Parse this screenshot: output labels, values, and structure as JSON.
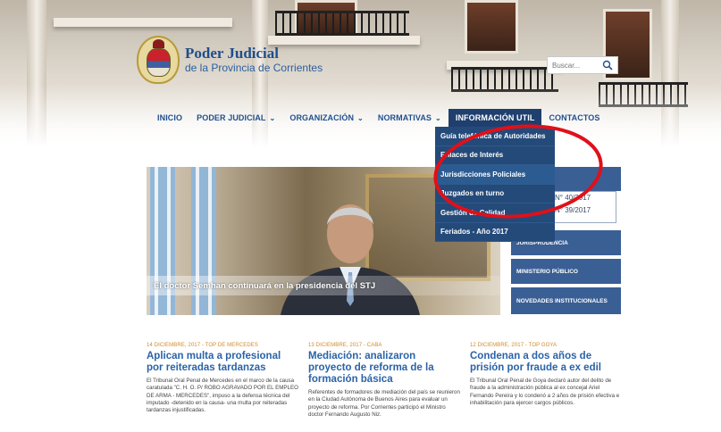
{
  "header": {
    "logo_title": "Poder Judicial",
    "logo_subtitle": "de la Provincia de Corrientes",
    "search_placeholder": "Buscar..."
  },
  "nav": {
    "items": [
      {
        "label": "INICIO"
      },
      {
        "label": "PODER JUDICIAL"
      },
      {
        "label": "ORGANIZACIÓN"
      },
      {
        "label": "NORMATIVAS"
      },
      {
        "label": "INFORMACIÓN UTIL"
      },
      {
        "label": "CONTACTOS"
      }
    ]
  },
  "dropdown": {
    "items": [
      {
        "label": "Guía telefónica de Autoridades"
      },
      {
        "label": "Enlaces de Interés"
      },
      {
        "label": "Jurisdicciones Policiales"
      },
      {
        "label": "Juzgados en turno"
      },
      {
        "label": "Gestión de Calidad"
      },
      {
        "label": "Feriados - Año 2017"
      }
    ],
    "highlighted_index": 2
  },
  "slider": {
    "caption": "El doctor Semhan continuará en la presidencia del STJ"
  },
  "sidebar": {
    "acordadas": [
      "N° 40/2017",
      "N° 39/2017"
    ],
    "items": [
      {
        "label": "JURISPRUDENCIA"
      },
      {
        "label": "MINISTERIO PÚBLICO"
      },
      {
        "label": "NOVEDADES INSTITUCIONALES"
      }
    ]
  },
  "news": [
    {
      "meta": "14 DICIEMBRE, 2017 - TOP DE MERCEDES",
      "title": "Aplican multa a profesional por reiteradas tardanzas",
      "body": "El Tribunal Oral Penal de Mercedes en el marco de la causa caratulada \"C. H. O. P/ ROBO AGRAVADO POR EL EMPLEO DE ARMA - MERCEDES\", impuso a la defensa técnica del imputado -detenido en la causa- una multa por reiteradas tardanzas injustificadas."
    },
    {
      "meta": "13 DICIEMBRE, 2017 - CABA",
      "title": "Mediación: analizaron proyecto de reforma de la formación básica",
      "body": "Referentes de formadores de mediación del país se reunieron en la Ciudad Autónoma de Buenos Aires para evaluar un proyecto de reforma. Por Corrientes participó el Ministro doctor Fernando Augusto Niz."
    },
    {
      "meta": "12 DICIEMBRE, 2017 - TOP GOYA",
      "title": "Condenan a dos años de prisión por fraude a ex edil",
      "body": "El Tribunal Oral Penal de Goya declaró autor del delito de fraude a la administración pública al ex concejal Ariel Fernando Pereira y lo condenó a 2 años de prisión efectiva e inhabilitación para ejercer cargos públicos."
    }
  ],
  "colors": {
    "nav_text": "#1f4f8f",
    "nav_active_bg": "#1f3f6e",
    "dropdown_bg": "#244a7a",
    "sidebar_bg": "#3a5f95",
    "news_title": "#2a63a8",
    "news_meta": "#d08a2b",
    "annotation": "#e0101a"
  }
}
